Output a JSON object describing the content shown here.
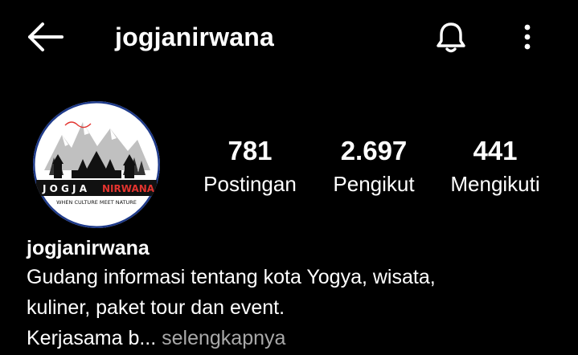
{
  "header": {
    "title": "jogjanirwana",
    "back_icon": "arrow-left-icon",
    "notification_icon": "bell-icon",
    "menu_icon": "more-vertical-icon"
  },
  "profile": {
    "avatar": {
      "logo_text_main": "J O G J A",
      "logo_text_accent": "NIRWANA",
      "logo_tagline": "WHEN CULTURE MEET NATURE",
      "accent_color": "#e3342f",
      "border_color": "#1e3a8a"
    },
    "stats": [
      {
        "value": "781",
        "label": "Postingan"
      },
      {
        "value": "2.697",
        "label": "Pengikut"
      },
      {
        "value": "441",
        "label": "Mengikuti"
      }
    ],
    "bio": {
      "name": "jogjanirwana",
      "line1": "Gudang informasi tentang kota Yogya, wisata,",
      "line2": "kuliner, paket tour dan event.",
      "line3_text": "Kerjasama b...",
      "more_label": "selengkapnya"
    }
  },
  "colors": {
    "background": "#000000",
    "text": "#ffffff",
    "muted": "#a8a8a8"
  }
}
